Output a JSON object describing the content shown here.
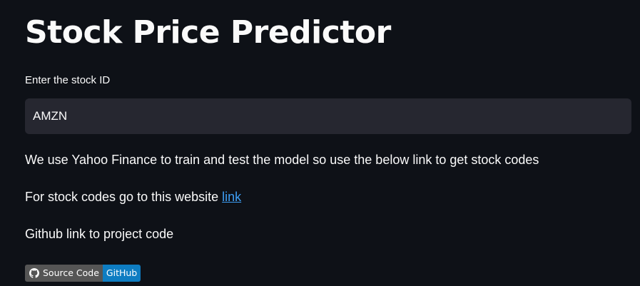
{
  "app": {
    "title": "Stock Price Predictor"
  },
  "stock_input": {
    "label": "Enter the stock ID",
    "value": "AMZN"
  },
  "info": {
    "yahoo_text": "We use Yahoo Finance to train and test the model so use the below link to get stock codes",
    "codes_prefix": "For stock codes go to this website ",
    "codes_link": "link",
    "github_text": "Github link to project code"
  },
  "badge": {
    "icon": "github-icon",
    "left_label": "Source Code",
    "right_label": "GitHub"
  },
  "colors": {
    "background": "#0e1117",
    "input_background": "#262730",
    "link": "#3d9df3",
    "badge_left": "#555555",
    "badge_right": "#0e7dc2"
  }
}
